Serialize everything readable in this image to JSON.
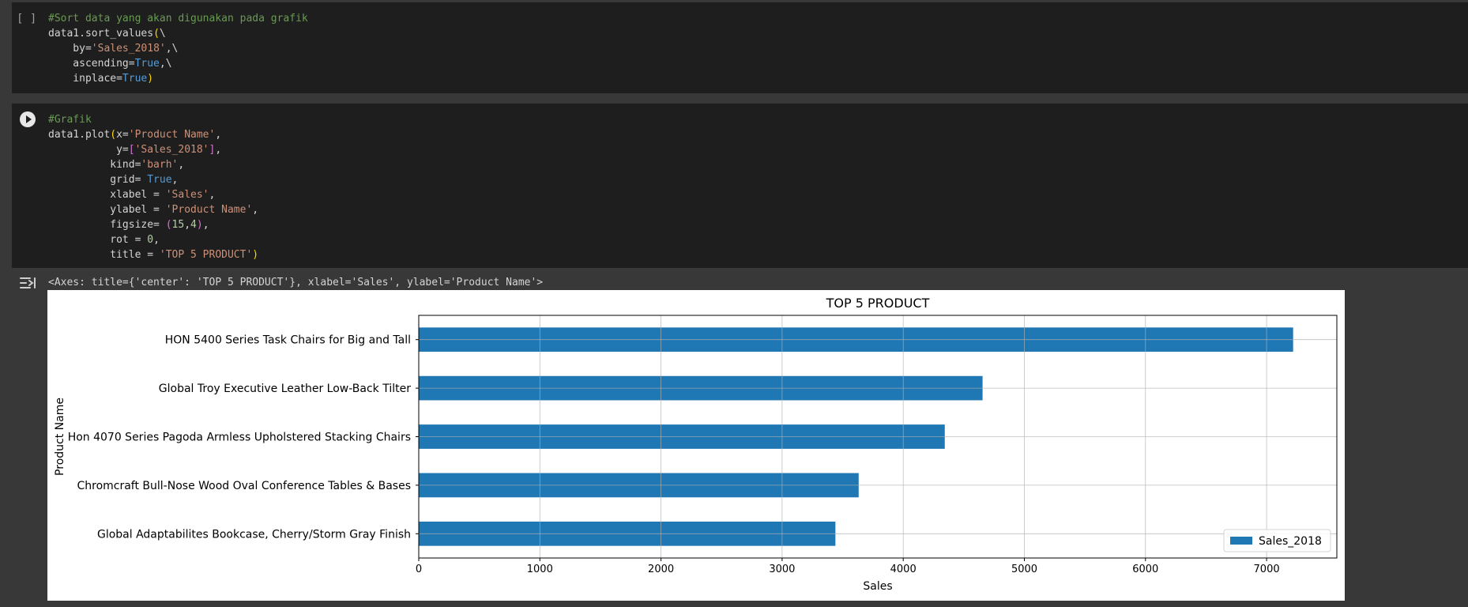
{
  "cell1": {
    "prompt": "[ ]",
    "lines": [
      [
        {
          "t": "#Sort data yang akan digunakan pada grafik",
          "c": "comment"
        }
      ],
      [
        {
          "t": "data1.sort_values",
          "c": ""
        },
        {
          "t": "(",
          "c": "paren"
        },
        {
          "t": "\\",
          "c": ""
        }
      ],
      [
        {
          "t": "    by=",
          "c": ""
        },
        {
          "t": "'Sales_2018'",
          "c": "str"
        },
        {
          "t": ",\\",
          "c": ""
        }
      ],
      [
        {
          "t": "    ascending=",
          "c": ""
        },
        {
          "t": "True",
          "c": "kw"
        },
        {
          "t": ",\\",
          "c": ""
        }
      ],
      [
        {
          "t": "    inplace=",
          "c": ""
        },
        {
          "t": "True",
          "c": "kw"
        },
        {
          "t": ")",
          "c": "paren"
        }
      ]
    ]
  },
  "cell2": {
    "lines": [
      [
        {
          "t": "#Grafik",
          "c": "comment"
        }
      ],
      [
        {
          "t": "data1.plot",
          "c": ""
        },
        {
          "t": "(",
          "c": "paren"
        },
        {
          "t": "x=",
          "c": ""
        },
        {
          "t": "'Product Name'",
          "c": "str"
        },
        {
          "t": ",",
          "c": ""
        }
      ],
      [
        {
          "t": "           y=",
          "c": ""
        },
        {
          "t": "[",
          "c": "paren2"
        },
        {
          "t": "'Sales_2018'",
          "c": "str"
        },
        {
          "t": "]",
          "c": "paren2"
        },
        {
          "t": ",",
          "c": ""
        }
      ],
      [
        {
          "t": "          kind=",
          "c": ""
        },
        {
          "t": "'barh'",
          "c": "str"
        },
        {
          "t": ",",
          "c": ""
        }
      ],
      [
        {
          "t": "          grid= ",
          "c": ""
        },
        {
          "t": "True",
          "c": "kw"
        },
        {
          "t": ",",
          "c": ""
        }
      ],
      [
        {
          "t": "          xlabel = ",
          "c": ""
        },
        {
          "t": "'Sales'",
          "c": "str"
        },
        {
          "t": ",",
          "c": ""
        }
      ],
      [
        {
          "t": "          ylabel = ",
          "c": ""
        },
        {
          "t": "'Product Name'",
          "c": "str"
        },
        {
          "t": ",",
          "c": ""
        }
      ],
      [
        {
          "t": "          figsize= ",
          "c": ""
        },
        {
          "t": "(",
          "c": "paren2"
        },
        {
          "t": "15",
          "c": "num"
        },
        {
          "t": ",",
          "c": ""
        },
        {
          "t": "4",
          "c": "num"
        },
        {
          "t": ")",
          "c": "paren2"
        },
        {
          "t": ",",
          "c": ""
        }
      ],
      [
        {
          "t": "          rot = ",
          "c": ""
        },
        {
          "t": "0",
          "c": "num"
        },
        {
          "t": ",",
          "c": ""
        }
      ],
      [
        {
          "t": "          title = ",
          "c": ""
        },
        {
          "t": "'TOP 5 PRODUCT'",
          "c": "str"
        },
        {
          "t": ")",
          "c": "paren"
        }
      ]
    ]
  },
  "output": {
    "repr": "<Axes: title={'center': 'TOP 5 PRODUCT'}, xlabel='Sales', ylabel='Product Name'>"
  },
  "chart_data": {
    "type": "bar",
    "orientation": "horizontal",
    "title": "TOP 5 PRODUCT",
    "xlabel": "Sales",
    "ylabel": "Product Name",
    "categories": [
      "HON 5400 Series Task Chairs for Big and Tall",
      "Global Troy Executive Leather Low-Back Tilter",
      "Hon 4070 Series Pagoda Armless Upholstered Stacking Chairs",
      "Chromcraft Bull-Nose Wood Oval Conference Tables & Bases",
      "Global Adaptabilites Bookcase, Cherry/Storm Gray Finish"
    ],
    "series": [
      {
        "name": "Sales_2018",
        "values": [
          7219,
          4655,
          4343,
          3632,
          3440
        ],
        "color": "#1f77b4"
      }
    ],
    "xlim": [
      0,
      7580
    ],
    "xticks": [
      0,
      1000,
      2000,
      3000,
      4000,
      5000,
      6000,
      7000
    ],
    "grid": true,
    "legend": "lower-right"
  }
}
